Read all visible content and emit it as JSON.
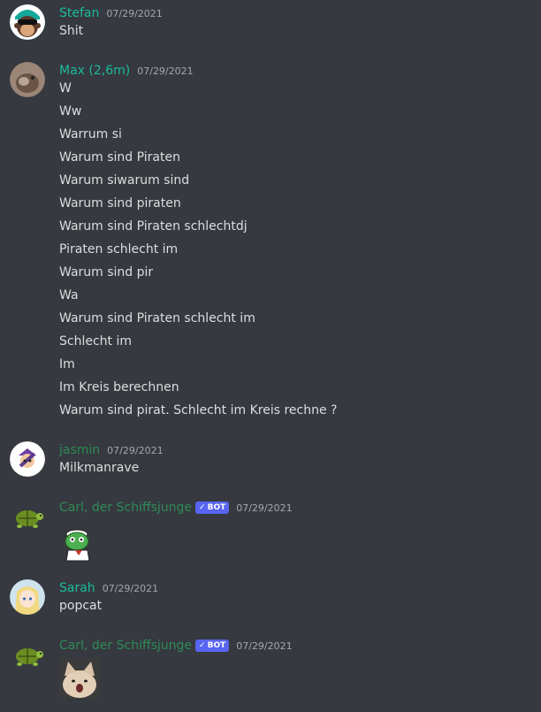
{
  "colors": {
    "background": "#36393f",
    "name_teal": "#1abc9c",
    "name_green": "#2e8b57",
    "bot_badge": "#5865f2"
  },
  "messages": [
    {
      "author": "Stefan",
      "timestamp": "07/29/2021",
      "avatar": "monkey-avatar",
      "lines": [
        "Shit"
      ]
    },
    {
      "author": "Max (2,6m)",
      "timestamp": "07/29/2021",
      "avatar": "hamster-avatar",
      "lines": [
        "W",
        "Ww",
        "Warrum si",
        "Warum sind Piraten",
        "Warum siwarum sind",
        "Warum sind piraten",
        "Warum sind Piraten schlechtdj",
        "Piraten schlecht im",
        "Warum sind pir",
        "Wa",
        "Warum sind Piraten schlecht im",
        "Schlecht im",
        "Im",
        "Im Kreis berechnen",
        "Warum sind pirat. Schlecht im Kreis rechne ?"
      ]
    },
    {
      "author": "jasmin",
      "timestamp": "07/29/2021",
      "avatar": "character-avatar",
      "lines": [
        "Milkmanrave"
      ]
    },
    {
      "author": "Carl, der Schiffsjunge",
      "badge": "BOT",
      "timestamp": "07/29/2021",
      "avatar": "turtle-avatar",
      "content": "frog-sailor-emote"
    },
    {
      "author": "Sarah",
      "timestamp": "07/29/2021",
      "avatar": "anime-girl-avatar",
      "lines": [
        "popcat"
      ]
    },
    {
      "author": "Carl, der Schiffsjunge",
      "badge": "BOT",
      "timestamp": "07/29/2021",
      "avatar": "turtle-avatar",
      "content": "popcat-emote"
    }
  ]
}
